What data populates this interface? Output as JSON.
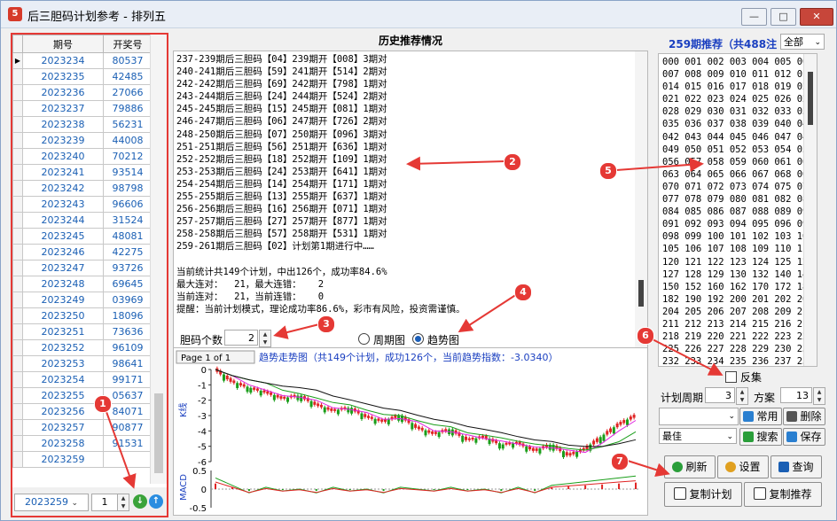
{
  "window": {
    "title": "后三胆码计划参考 - 排列五",
    "icon_label": "5"
  },
  "left_grid": {
    "headers": [
      "期号",
      "开奖号"
    ],
    "rows": [
      [
        "2023234",
        "80537"
      ],
      [
        "2023235",
        "42485"
      ],
      [
        "2023236",
        "27066"
      ],
      [
        "2023237",
        "79886"
      ],
      [
        "2023238",
        "56231"
      ],
      [
        "2023239",
        "44008"
      ],
      [
        "2023240",
        "70212"
      ],
      [
        "2023241",
        "93514"
      ],
      [
        "2023242",
        "98798"
      ],
      [
        "2023243",
        "96606"
      ],
      [
        "2023244",
        "31524"
      ],
      [
        "2023245",
        "48081"
      ],
      [
        "2023246",
        "42275"
      ],
      [
        "2023247",
        "93726"
      ],
      [
        "2023248",
        "69645"
      ],
      [
        "2023249",
        "03969"
      ],
      [
        "2023250",
        "18096"
      ],
      [
        "2023251",
        "73636"
      ],
      [
        "2023252",
        "96109"
      ],
      [
        "2023253",
        "98641"
      ],
      [
        "2023254",
        "99171"
      ],
      [
        "2023255",
        "05637"
      ],
      [
        "2023256",
        "84071"
      ],
      [
        "2023257",
        "90877"
      ],
      [
        "2023258",
        "91531"
      ],
      [
        "2023259",
        ""
      ]
    ],
    "period_select": "2023259",
    "count_value": "1"
  },
  "history": {
    "heading": "历史推荐情况",
    "lines": [
      "237-239期后三胆码【04】239期开【008】3期对",
      "240-241期后三胆码【59】241期开【514】2期对",
      "242-242期后三胆码【69】242期开【798】1期对",
      "243-244期后三胆码【24】244期开【524】2期对",
      "245-245期后三胆码【15】245期开【081】1期对",
      "246-247期后三胆码【06】247期开【726】2期对",
      "248-250期后三胆码【07】250期开【096】3期对",
      "251-251期后三胆码【56】251期开【636】1期对",
      "252-252期后三胆码【18】252期开【109】1期对",
      "253-253期后三胆码【24】253期开【641】1期对",
      "254-254期后三胆码【14】254期开【171】1期对",
      "255-255期后三胆码【13】255期开【637】1期对",
      "256-256期后三胆码【16】256期开【071】1期对",
      "257-257期后三胆码【27】257期开【877】1期对",
      "258-258期后三胆码【57】258期开【531】1期对",
      "259-261期后三胆码【02】计划第1期进行中……",
      "",
      "当前统计共149个计划，中出126个，成功率84.6%",
      "最大连对：  21，最大连错：   2",
      "当前连对：  21，当前连错：   0",
      "提醒：当前计划模式，理论成功率86.6%，彩市有风险，投资需谨慎。"
    ]
  },
  "controls": {
    "count_label": "胆码个数",
    "count_value": "2",
    "radio_period": "周期图",
    "radio_trend": "趋势图",
    "selected": "趋势图"
  },
  "chart": {
    "page_label": "Page 1 of 1",
    "title": "趋势走势图（共149个计划，成功126个，当前趋势指数：-3.0340）",
    "k_axis_label": "K线",
    "macd_axis_label": "MACD",
    "k_ticks": [
      "0",
      "-1",
      "-2",
      "-3",
      "-4",
      "-5",
      "-6"
    ],
    "macd_ticks": [
      "0.5",
      "0",
      "-0.5"
    ],
    "colors": {
      "up": "#e02424",
      "down": "#1a9e1a",
      "ma1": "#e024e0",
      "ma2": "#1a9e1a",
      "ma3": "#111111"
    }
  },
  "chart_data": {
    "type": "line",
    "title": "趋势走势图（共149个计划，成功126个，当前趋势指数：-3.0340）",
    "ylabel": "K线",
    "ylim": [
      -6,
      0
    ],
    "trend_values": [
      0.0,
      -0.8,
      -1.2,
      -1.5,
      -1.9,
      -1.7,
      -2.3,
      -2.7,
      -2.5,
      -3.1,
      -3.4,
      -3.0,
      -3.8,
      -4.2,
      -3.9,
      -4.6,
      -4.4,
      -4.9,
      -4.8,
      -5.3,
      -4.9,
      -5.6,
      -5.2,
      -4.4,
      -3.6,
      -3.03
    ],
    "macd": {
      "ylim": [
        -0.5,
        0.5
      ],
      "values": [
        0.3,
        0.1,
        -0.1,
        0.05,
        -0.05,
        0.0,
        -0.1,
        0.05,
        -0.05,
        0.0,
        -0.1,
        0.05,
        0.0,
        -0.05,
        0.05,
        -0.05,
        0.0,
        -0.1,
        0.05,
        -0.1,
        0.1,
        0.15,
        0.2,
        0.25,
        0.3,
        0.35
      ]
    }
  },
  "right": {
    "header": "259期推荐（共488注",
    "filter": "全部",
    "numbers": [
      "000 001 002 003 004 005 006",
      "007 008 009 010 011 012 013",
      "014 015 016 017 018 019 020",
      "021 022 023 024 025 026 027",
      "028 029 030 031 032 033 034",
      "035 036 037 038 039 040 041",
      "042 043 044 045 046 047 048",
      "049 050 051 052 053 054 055",
      "056 057 058 059 060 061 062",
      "063 064 065 066 067 068 069",
      "070 071 072 073 074 075 076",
      "077 078 079 080 081 082 083",
      "084 085 086 087 088 089 090",
      "091 092 093 094 095 096 097",
      "098 099 100 101 102 103 104",
      "105 106 107 108 109 110 112",
      "120 121 122 123 124 125 126",
      "127 128 129 130 132 140 142",
      "150 152 160 162 170 172 180",
      "182 190 192 200 201 202 203",
      "204 205 206 207 208 209 210",
      "211 212 213 214 215 216 217",
      "218 219 220 221 222 223 224",
      "225 226 227 228 229 230 231",
      "232 233 234 235 236 237 238"
    ],
    "reverse_label": "反集",
    "period_label": "计划周期",
    "period_value": "3",
    "scheme_label": "方案",
    "scheme_value": "13",
    "common_btn": "常用",
    "delete_btn": "删除",
    "best_select": "最佳",
    "search_btn": "搜索",
    "save_btn": "保存",
    "refresh_btn": "刷新",
    "settings_btn": "设置",
    "query_btn": "查询",
    "copy_plan_btn": "复制计划",
    "copy_rec_btn": "复制推荐"
  },
  "callouts": [
    "1",
    "2",
    "3",
    "4",
    "5",
    "6",
    "7"
  ]
}
